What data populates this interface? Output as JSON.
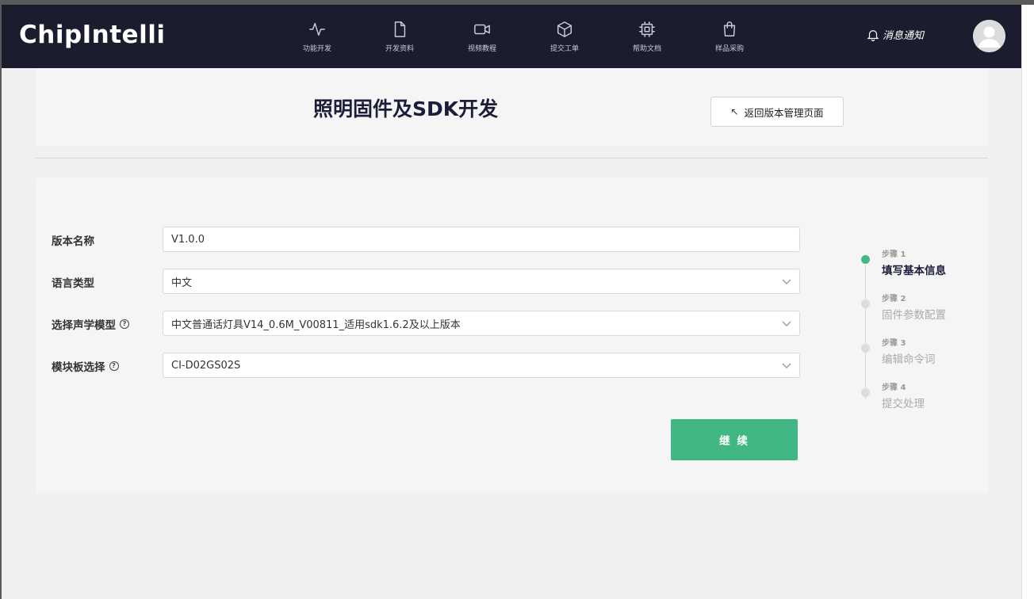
{
  "header": {
    "logo": "ChipIntelli",
    "nav": [
      {
        "label": "功能开发",
        "icon": "activity-icon"
      },
      {
        "label": "开发资料",
        "icon": "file-icon"
      },
      {
        "label": "视频教程",
        "icon": "video-icon"
      },
      {
        "label": "提交工单",
        "icon": "cube-icon"
      },
      {
        "label": "帮助文档",
        "icon": "chip-icon"
      },
      {
        "label": "样品采购",
        "icon": "shopping-bag-icon"
      }
    ],
    "notifications_label": "消息通知"
  },
  "title_card": {
    "title": "照明固件及SDK开发",
    "back_button_label": "返回版本管理页面"
  },
  "form": {
    "version_name": {
      "label": "版本名称",
      "value": "V1.0.0"
    },
    "language": {
      "label": "语言类型",
      "value": "中文"
    },
    "acoustic_model": {
      "label": "选择声学模型",
      "value": "中文普通话灯具V14_0.6M_V00811_适用sdk1.6.2及以上版本"
    },
    "module_board": {
      "label": "模块板选择",
      "value": "CI-D02GS02S"
    },
    "continue_label": "继 续"
  },
  "steps": [
    {
      "num": "步骤 1",
      "title": "填写基本信息",
      "active": true
    },
    {
      "num": "步骤 2",
      "title": "固件参数配置",
      "active": false
    },
    {
      "num": "步骤 3",
      "title": "编辑命令词",
      "active": false
    },
    {
      "num": "步骤 4",
      "title": "提交处理",
      "active": false
    }
  ],
  "colors": {
    "header_bg": "#1b1d2e",
    "accent": "#41b883"
  }
}
